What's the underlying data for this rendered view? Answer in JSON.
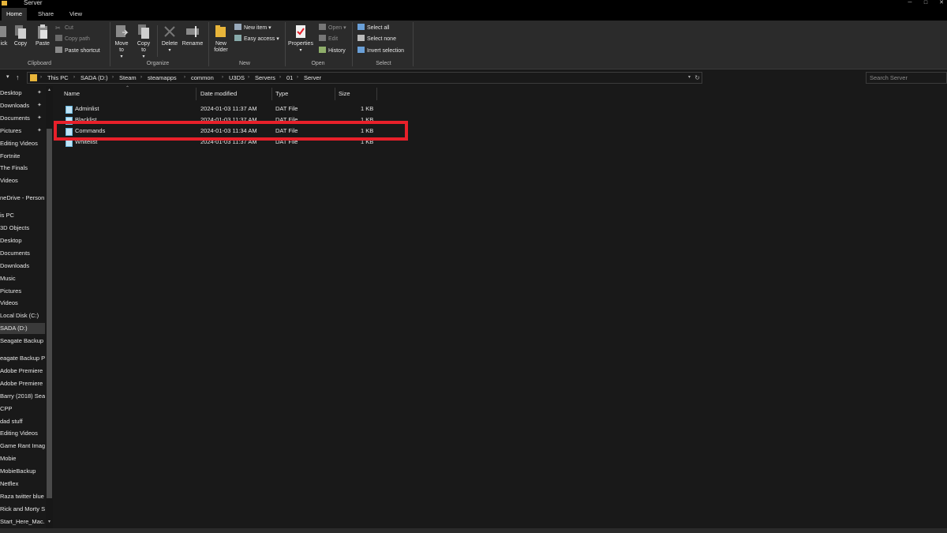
{
  "window": {
    "title": "Server"
  },
  "ribbon": {
    "tabs": [
      "Home",
      "Share",
      "View"
    ],
    "clipboard": {
      "pin_label": "ick",
      "copy_label": "Copy",
      "paste_label": "Paste",
      "cut_label": "Cut",
      "copy_path_label": "Copy path",
      "paste_shortcut_label": "Paste shortcut",
      "group_label": "Clipboard"
    },
    "organize": {
      "move_to_label": "Move to",
      "copy_to_label": "Copy to",
      "delete_label": "Delete",
      "rename_label": "Rename",
      "group_label": "Organize"
    },
    "new": {
      "new_folder_label": "New folder",
      "new_item_label": "New item",
      "easy_access_label": "Easy access",
      "group_label": "New"
    },
    "open": {
      "properties_label": "Properties",
      "open_label": "Open",
      "edit_label": "Edit",
      "history_label": "History",
      "group_label": "Open"
    },
    "select": {
      "select_all_label": "Select all",
      "select_none_label": "Select none",
      "invert_label": "Invert selection",
      "group_label": "Select"
    }
  },
  "address": {
    "crumbs": [
      "This PC",
      "SADA (D:)",
      "Steam",
      "steamapps",
      "common",
      "U3DS",
      "Servers",
      "01",
      "Server"
    ]
  },
  "search": {
    "placeholder": "Search Server"
  },
  "nav": {
    "items": [
      "Desktop",
      "Downloads",
      "Documents",
      "Pictures",
      "Editing Videos",
      "Fortnite",
      "The Finals",
      "Videos",
      "neDrive - Person",
      "is PC",
      "3D Objects",
      "Desktop",
      "Documents",
      "Downloads",
      "Music",
      "Pictures",
      "Videos",
      "Local Disk (C:)",
      "SADA (D:)",
      "Seagate Backup",
      "eagate Backup P",
      "Adobe Premiere",
      "Adobe Premiere",
      "Barry (2018) Seas",
      "CPP",
      "dad stuff",
      "Editing Videos",
      "Game Rant Imag",
      "Mobie",
      "MobieBackup",
      "Netflex",
      "Raza twitter blue",
      "Rick and Morty S",
      "Start_Here_Mac."
    ],
    "selected_index": 18
  },
  "files": {
    "columns": [
      "Name",
      "Date modified",
      "Type",
      "Size"
    ],
    "rows": [
      {
        "name": "Adminlist",
        "date": "2024-01-03 11:37 AM",
        "type": "DAT File",
        "size": "1 KB"
      },
      {
        "name": "Blacklist",
        "date": "2024-01-03 11:37 AM",
        "type": "DAT File",
        "size": "1 KB"
      },
      {
        "name": "Commands",
        "date": "2024-01-03 11:34 AM",
        "type": "DAT File",
        "size": "1 KB"
      },
      {
        "name": "Whitelist",
        "date": "2024-01-03 11:37 AM",
        "type": "DAT File",
        "size": "1 KB"
      }
    ],
    "highlighted_row_index": 2
  },
  "colors": {
    "background": "#191919",
    "ribbon": "#2b2b2b",
    "highlight_box": "#e8202a",
    "folder": "#e8b53a"
  }
}
